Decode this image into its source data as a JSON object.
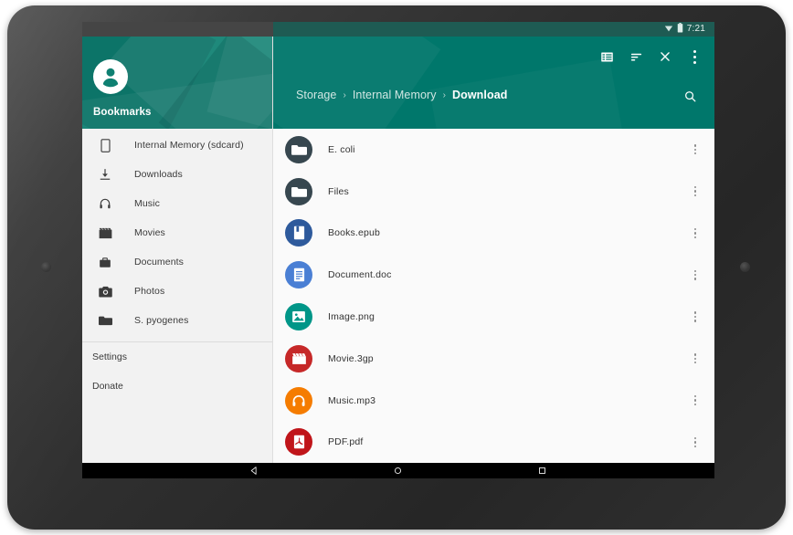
{
  "device": {
    "type": "android-tablet",
    "frame_color": "#2e2e2e"
  },
  "status_bar": {
    "clock": "7:21",
    "icons": [
      "wifi-icon",
      "battery-icon"
    ],
    "background": "#1e5b53"
  },
  "drawer": {
    "account_name": "Bookmarks",
    "avatar_icon": "account-circle-icon",
    "header_color": "#0f8072",
    "items": [
      {
        "label": "Internal Memory (sdcard)",
        "icon": "phone-android-icon"
      },
      {
        "label": "Downloads",
        "icon": "download-icon"
      },
      {
        "label": "Music",
        "icon": "headphones-icon"
      },
      {
        "label": "Movies",
        "icon": "movie-clapper-icon"
      },
      {
        "label": "Documents",
        "icon": "briefcase-icon"
      },
      {
        "label": "Photos",
        "icon": "camera-icon"
      },
      {
        "label": "S. pyogenes",
        "icon": "folder-icon"
      }
    ],
    "footer_items": [
      {
        "label": "Settings"
      },
      {
        "label": "Donate"
      }
    ]
  },
  "toolbar": {
    "background": "#00776b",
    "actions": [
      {
        "name": "view-list-icon",
        "label": "View mode"
      },
      {
        "name": "sort-icon",
        "label": "Sort"
      },
      {
        "name": "close-icon",
        "label": "Close"
      },
      {
        "name": "overflow-menu-icon",
        "label": "More options"
      }
    ],
    "search_icon": "search-icon",
    "breadcrumb": [
      {
        "label": "Storage",
        "current": false
      },
      {
        "label": "Internal Memory",
        "current": false
      },
      {
        "label": "Download",
        "current": true
      }
    ],
    "breadcrumb_separator": "›"
  },
  "file_list": {
    "row_overflow_icon": "overflow-menu-icon",
    "rows": [
      {
        "name": "E. coli",
        "icon": "folder-icon",
        "color": "#37474f",
        "kind": "folder"
      },
      {
        "name": "Files",
        "icon": "folder-icon",
        "color": "#37474f",
        "kind": "folder"
      },
      {
        "name": "Books.epub",
        "icon": "book-icon",
        "color": "#2e5a9c",
        "kind": "ebook"
      },
      {
        "name": "Document.doc",
        "icon": "document-icon",
        "color": "#4a7fd4",
        "kind": "document"
      },
      {
        "name": "Image.png",
        "icon": "image-icon",
        "color": "#009688",
        "kind": "image"
      },
      {
        "name": "Movie.3gp",
        "icon": "movie-clapper-icon",
        "color": "#c62828",
        "kind": "video"
      },
      {
        "name": "Music.mp3",
        "icon": "headphones-icon",
        "color": "#f57c00",
        "kind": "audio"
      },
      {
        "name": "PDF.pdf",
        "icon": "pdf-icon",
        "color": "#c0151a",
        "kind": "pdf"
      }
    ]
  },
  "nav_bar": {
    "buttons": [
      {
        "name": "back-button",
        "icon": "triangle-back-icon"
      },
      {
        "name": "home-button",
        "icon": "circle-home-icon"
      },
      {
        "name": "recents-button",
        "icon": "square-recents-icon"
      }
    ]
  }
}
